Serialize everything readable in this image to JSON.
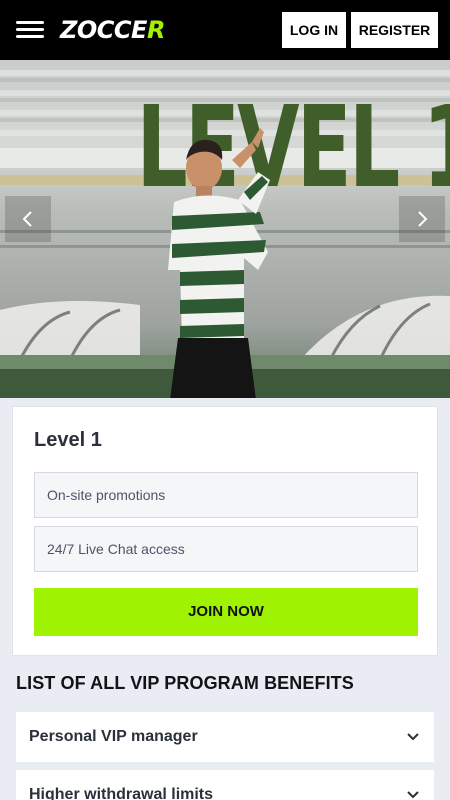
{
  "header": {
    "logo_main": "ZOCCE",
    "logo_accent": "R",
    "login_label": "LOG IN",
    "register_label": "REGISTER"
  },
  "hero": {
    "headline": "LEVEL 1",
    "prev_icon": "chevron-left-icon",
    "next_icon": "chevron-right-icon"
  },
  "level_card": {
    "title": "Level 1",
    "benefits": [
      "On-site promotions",
      "24/7 Live Chat access"
    ],
    "join_label": "JOIN NOW"
  },
  "vip": {
    "title": "LIST OF ALL VIP PROGRAM BENEFITS",
    "items": [
      {
        "label": "Personal VIP manager",
        "icon": "chevron-down-icon"
      },
      {
        "label": "Higher withdrawal limits",
        "icon": "chevron-down-icon"
      }
    ]
  },
  "colors": {
    "accent": "#9ff201",
    "header_bg": "#000000",
    "headline_green": "#3f5e2a",
    "page_bg": "#e9ecf2"
  }
}
